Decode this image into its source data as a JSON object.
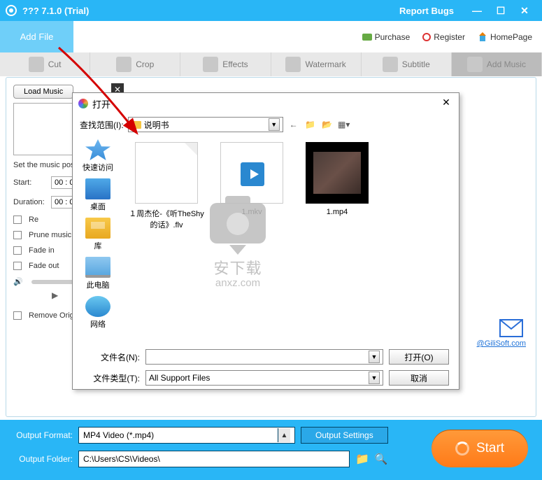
{
  "titlebar": {
    "title": "??? 7.1.0 (Trial)",
    "report": "Report Bugs"
  },
  "toolbar": {
    "add_file": "Add File",
    "links": {
      "purchase": "Purchase",
      "register": "Register",
      "homepage": "HomePage"
    }
  },
  "tabs": {
    "cut": "Cut",
    "crop": "Crop",
    "effects": "Effects",
    "watermark": "Watermark",
    "subtitle": "Subtitle",
    "addmusic": "Add Music"
  },
  "panel": {
    "load_music": "Load Music",
    "set_pos": "Set the music pos",
    "start_label": "Start:",
    "start_val": "00 : 0",
    "duration_label": "Duration:",
    "duration_val": "00 : 0",
    "rep_label": "Re",
    "prune": "Prune music",
    "fadein": "Fade in",
    "fadeout": "Fade out",
    "remove_orig": "Remove Orig",
    "mail_link": "@GiliSoft.com"
  },
  "dialog": {
    "title": "打开",
    "lookin_label": "查找范围(I):",
    "lookin_value": "说明书",
    "side": {
      "quick": "快速访问",
      "desktop": "桌面",
      "lib": "库",
      "pc": "此电脑",
      "net": "网络"
    },
    "files": [
      {
        "name": "１周杰伦-《听TheShy的话》.flv"
      },
      {
        "name": "1.mkv"
      },
      {
        "name": "1.mp4"
      }
    ],
    "filename_label": "文件名(N):",
    "filename_value": "",
    "filetype_label": "文件类型(T):",
    "filetype_value": "All Support Files",
    "open_btn": "打开(O)",
    "cancel_btn": "取消"
  },
  "watermark": {
    "text": "安下载",
    "url": "anxz.com"
  },
  "bottom": {
    "format_label": "Output Format:",
    "format_value": "MP4 Video (*.mp4)",
    "settings_btn": "Output Settings",
    "folder_label": "Output Folder:",
    "folder_value": "C:\\Users\\CS\\Videos\\",
    "start_btn": "Start"
  }
}
